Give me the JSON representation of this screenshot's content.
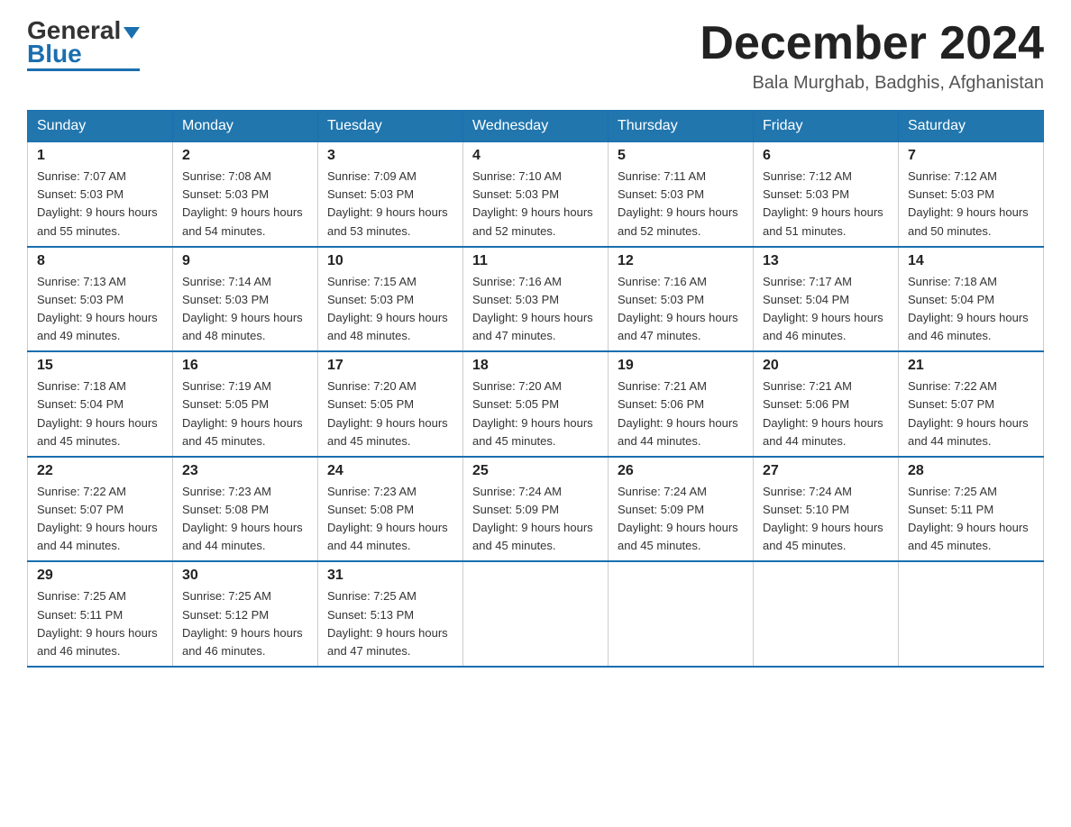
{
  "header": {
    "logo_general": "General",
    "logo_blue": "Blue",
    "month_title": "December 2024",
    "location": "Bala Murghab, Badghis, Afghanistan"
  },
  "days_of_week": [
    "Sunday",
    "Monday",
    "Tuesday",
    "Wednesday",
    "Thursday",
    "Friday",
    "Saturday"
  ],
  "weeks": [
    [
      {
        "day": "1",
        "sunrise": "7:07 AM",
        "sunset": "5:03 PM",
        "daylight": "9 hours and 55 minutes."
      },
      {
        "day": "2",
        "sunrise": "7:08 AM",
        "sunset": "5:03 PM",
        "daylight": "9 hours and 54 minutes."
      },
      {
        "day": "3",
        "sunrise": "7:09 AM",
        "sunset": "5:03 PM",
        "daylight": "9 hours and 53 minutes."
      },
      {
        "day": "4",
        "sunrise": "7:10 AM",
        "sunset": "5:03 PM",
        "daylight": "9 hours and 52 minutes."
      },
      {
        "day": "5",
        "sunrise": "7:11 AM",
        "sunset": "5:03 PM",
        "daylight": "9 hours and 52 minutes."
      },
      {
        "day": "6",
        "sunrise": "7:12 AM",
        "sunset": "5:03 PM",
        "daylight": "9 hours and 51 minutes."
      },
      {
        "day": "7",
        "sunrise": "7:12 AM",
        "sunset": "5:03 PM",
        "daylight": "9 hours and 50 minutes."
      }
    ],
    [
      {
        "day": "8",
        "sunrise": "7:13 AM",
        "sunset": "5:03 PM",
        "daylight": "9 hours and 49 minutes."
      },
      {
        "day": "9",
        "sunrise": "7:14 AM",
        "sunset": "5:03 PM",
        "daylight": "9 hours and 48 minutes."
      },
      {
        "day": "10",
        "sunrise": "7:15 AM",
        "sunset": "5:03 PM",
        "daylight": "9 hours and 48 minutes."
      },
      {
        "day": "11",
        "sunrise": "7:16 AM",
        "sunset": "5:03 PM",
        "daylight": "9 hours and 47 minutes."
      },
      {
        "day": "12",
        "sunrise": "7:16 AM",
        "sunset": "5:03 PM",
        "daylight": "9 hours and 47 minutes."
      },
      {
        "day": "13",
        "sunrise": "7:17 AM",
        "sunset": "5:04 PM",
        "daylight": "9 hours and 46 minutes."
      },
      {
        "day": "14",
        "sunrise": "7:18 AM",
        "sunset": "5:04 PM",
        "daylight": "9 hours and 46 minutes."
      }
    ],
    [
      {
        "day": "15",
        "sunrise": "7:18 AM",
        "sunset": "5:04 PM",
        "daylight": "9 hours and 45 minutes."
      },
      {
        "day": "16",
        "sunrise": "7:19 AM",
        "sunset": "5:05 PM",
        "daylight": "9 hours and 45 minutes."
      },
      {
        "day": "17",
        "sunrise": "7:20 AM",
        "sunset": "5:05 PM",
        "daylight": "9 hours and 45 minutes."
      },
      {
        "day": "18",
        "sunrise": "7:20 AM",
        "sunset": "5:05 PM",
        "daylight": "9 hours and 45 minutes."
      },
      {
        "day": "19",
        "sunrise": "7:21 AM",
        "sunset": "5:06 PM",
        "daylight": "9 hours and 44 minutes."
      },
      {
        "day": "20",
        "sunrise": "7:21 AM",
        "sunset": "5:06 PM",
        "daylight": "9 hours and 44 minutes."
      },
      {
        "day": "21",
        "sunrise": "7:22 AM",
        "sunset": "5:07 PM",
        "daylight": "9 hours and 44 minutes."
      }
    ],
    [
      {
        "day": "22",
        "sunrise": "7:22 AM",
        "sunset": "5:07 PM",
        "daylight": "9 hours and 44 minutes."
      },
      {
        "day": "23",
        "sunrise": "7:23 AM",
        "sunset": "5:08 PM",
        "daylight": "9 hours and 44 minutes."
      },
      {
        "day": "24",
        "sunrise": "7:23 AM",
        "sunset": "5:08 PM",
        "daylight": "9 hours and 44 minutes."
      },
      {
        "day": "25",
        "sunrise": "7:24 AM",
        "sunset": "5:09 PM",
        "daylight": "9 hours and 45 minutes."
      },
      {
        "day": "26",
        "sunrise": "7:24 AM",
        "sunset": "5:09 PM",
        "daylight": "9 hours and 45 minutes."
      },
      {
        "day": "27",
        "sunrise": "7:24 AM",
        "sunset": "5:10 PM",
        "daylight": "9 hours and 45 minutes."
      },
      {
        "day": "28",
        "sunrise": "7:25 AM",
        "sunset": "5:11 PM",
        "daylight": "9 hours and 45 minutes."
      }
    ],
    [
      {
        "day": "29",
        "sunrise": "7:25 AM",
        "sunset": "5:11 PM",
        "daylight": "9 hours and 46 minutes."
      },
      {
        "day": "30",
        "sunrise": "7:25 AM",
        "sunset": "5:12 PM",
        "daylight": "9 hours and 46 minutes."
      },
      {
        "day": "31",
        "sunrise": "7:25 AM",
        "sunset": "5:13 PM",
        "daylight": "9 hours and 47 minutes."
      },
      null,
      null,
      null,
      null
    ]
  ]
}
